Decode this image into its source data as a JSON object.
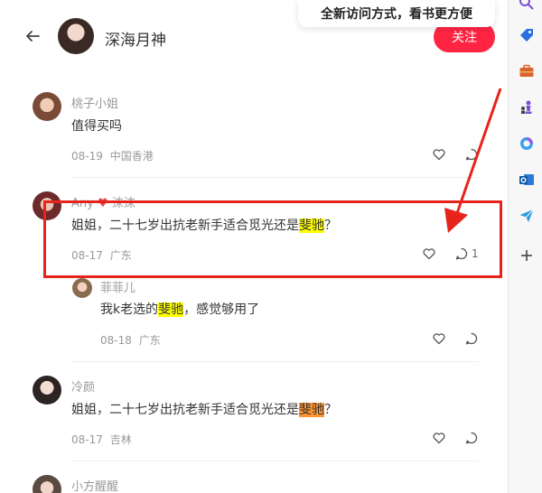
{
  "header": {
    "title": "深海月神",
    "follow_label": "关注",
    "tooltip": "全新访问方式，看书更方便"
  },
  "comments": [
    {
      "user": "桃子小姐",
      "text": "值得买吗",
      "date": "08-19",
      "location": "中国香港"
    },
    {
      "user": "Any",
      "user_suffix": "沫沫",
      "text_before": "姐姐，二十七岁出抗老新手适合觅光还是",
      "highlight": "斐驰",
      "text_after": "？",
      "date": "08-17",
      "location": "广东",
      "reply_count": "1"
    },
    {
      "user": "菲菲儿",
      "text_before": "我k老选的",
      "highlight": "斐驰",
      "text_after": "，感觉够用了",
      "date": "08-18",
      "location": "广东"
    },
    {
      "user": "冷颜",
      "text_before": "姐姐，二十七岁出抗老新手适合觅光还是",
      "highlight": "斐驰",
      "text_after": "？",
      "date": "08-17",
      "location": "吉林"
    },
    {
      "user": "小方醒醒"
    }
  ],
  "sidebar": {
    "icons": [
      "search-icon",
      "tag-icon",
      "briefcase-icon",
      "chess-icon",
      "copilot-icon",
      "outlook-icon",
      "send-icon",
      "add-icon"
    ]
  },
  "colors": {
    "accent": "#ff2442",
    "annotation": "#e8231b",
    "highlight_yellow": "#ffff00",
    "highlight_orange": "#ff9632"
  }
}
